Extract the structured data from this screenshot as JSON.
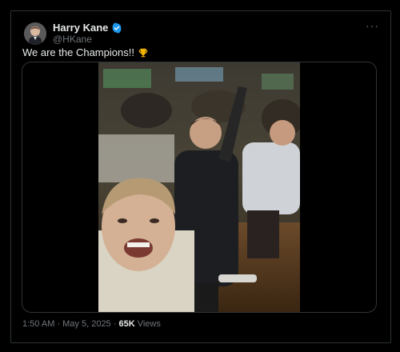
{
  "author": {
    "name": "Harry Kane",
    "handle": "@HKane",
    "verified": true,
    "verified_color": "#1d9bf0"
  },
  "tweet": {
    "text": "We are the Champions!!",
    "emoji": "trophy-icon"
  },
  "meta": {
    "time": "1:50 AM",
    "separator": " · ",
    "date": "May 5, 2025",
    "views_count": "65K",
    "views_label": "Views"
  },
  "more_icon": "···",
  "colors": {
    "background": "#000000",
    "text_primary": "#e7e9ea",
    "text_secondary": "#71767b",
    "border": "#2f3336"
  }
}
